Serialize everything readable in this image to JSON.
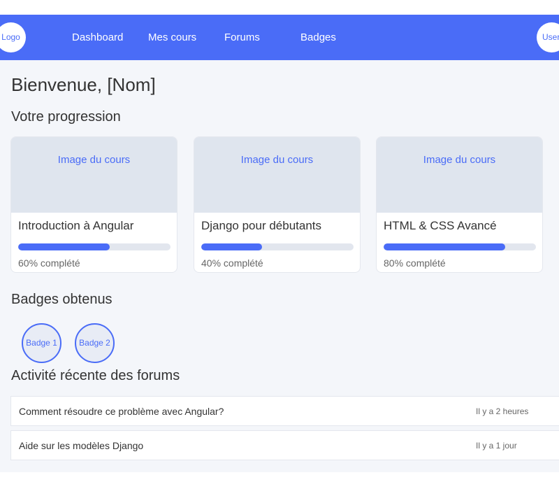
{
  "navbar": {
    "logo_label": "Logo",
    "links": [
      "Dashboard",
      "Mes cours",
      "Forums",
      "Badges"
    ],
    "user_label": "User"
  },
  "main": {
    "welcome": "Bienvenue, [Nom]",
    "progress_heading": "Votre progression",
    "courses": [
      {
        "image_label": "Image du cours",
        "title": "Introduction à Angular",
        "progress": 60,
        "progress_text": "60% complété"
      },
      {
        "image_label": "Image du cours",
        "title": "Django pour débutants",
        "progress": 40,
        "progress_text": "40% complété"
      },
      {
        "image_label": "Image du cours",
        "title": "HTML & CSS Avancé",
        "progress": 80,
        "progress_text": "80% complété"
      }
    ],
    "badges_heading": "Badges obtenus",
    "badges": [
      "Badge 1",
      "Badge 2"
    ],
    "forums_heading": "Activité récente des forums",
    "forum_items": [
      {
        "title": "Comment résoudre ce problème avec Angular?",
        "time": "Il y a 2 heures"
      },
      {
        "title": "Aide sur les modèles Django",
        "time": "Il y a 1 jour"
      }
    ]
  },
  "colors": {
    "primary": "#4a6cf7",
    "background": "#f4f6fa",
    "card_image_bg": "#dfe5ee",
    "progress_track": "#e2e6ee"
  }
}
